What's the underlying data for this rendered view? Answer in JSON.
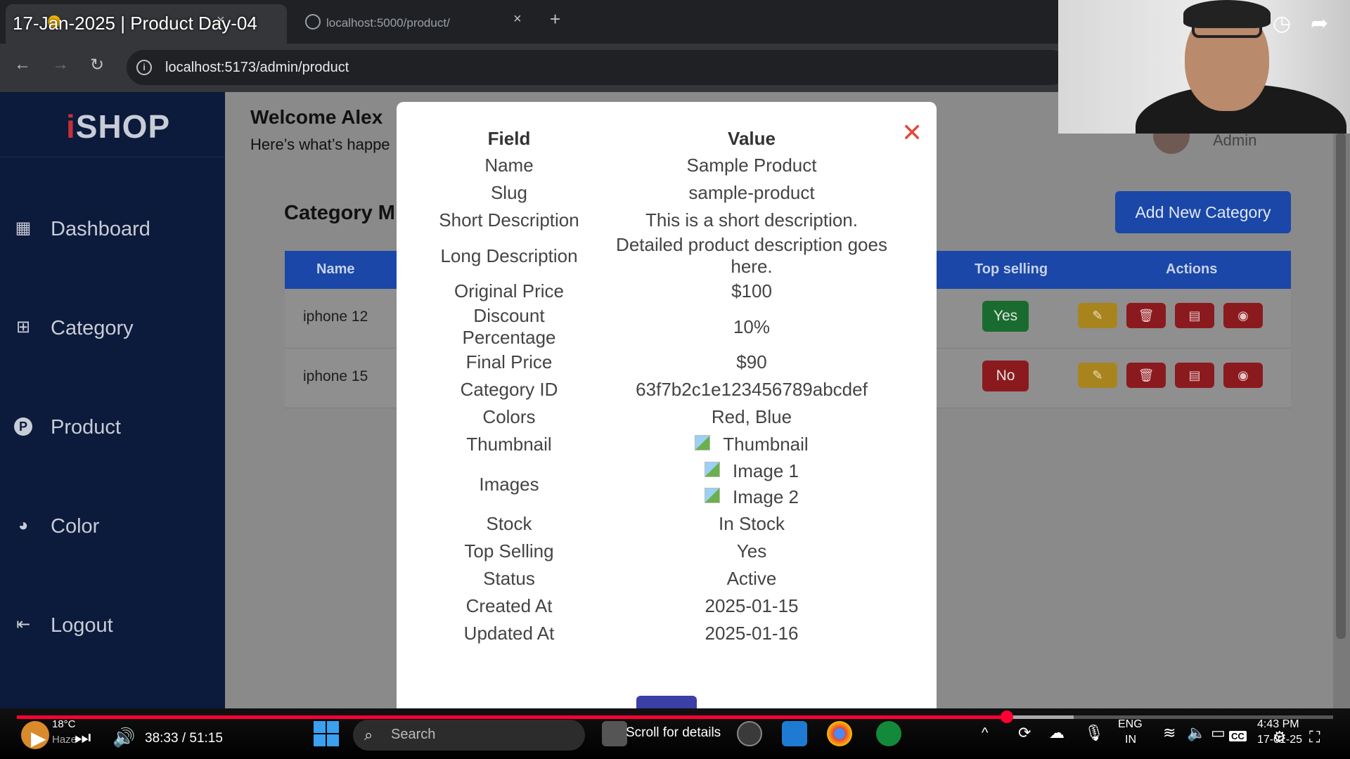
{
  "video": {
    "title": "17-Jan-2025 | Product Day-04"
  },
  "browser": {
    "tabs": [
      {
        "label": "",
        "url_label": ""
      },
      {
        "label": "localhost:5000/product/"
      }
    ],
    "address": "localhost:5173/admin/product"
  },
  "app": {
    "logo_i": "i",
    "logo_rest": "SHOP",
    "sidebar": [
      {
        "label": "Dashboard",
        "icon": "grid-icon"
      },
      {
        "label": "Category",
        "icon": "grid-plus-icon"
      },
      {
        "label": "Product",
        "icon": "product-p-icon"
      },
      {
        "label": "Color",
        "icon": "palette-icon"
      },
      {
        "label": "Logout",
        "icon": "logout-icon"
      }
    ],
    "header": {
      "welcome": "Welcome Alex",
      "subtitle": "Here’s what’s happe",
      "user_role": "Admin"
    },
    "section_title": "Category M",
    "add_button": "Add New Category",
    "table": {
      "headers": [
        "Name",
        "Top selling",
        "Actions"
      ],
      "rows": [
        {
          "name": "iphone 12",
          "top_selling": "Yes"
        },
        {
          "name": "iphone 15",
          "top_selling": "No"
        }
      ]
    }
  },
  "modal": {
    "header_field": "Field",
    "header_value": "Value",
    "rows": [
      {
        "field": "Name",
        "value": "Sample Product"
      },
      {
        "field": "Slug",
        "value": "sample-product"
      },
      {
        "field": "Short Description",
        "value": "This is a short description."
      },
      {
        "field": "Long Description",
        "value": "Detailed product description goes here."
      },
      {
        "field": "Original Price",
        "value": "$100"
      },
      {
        "field": "Discount Percentage",
        "value": "10%"
      },
      {
        "field": "Final Price",
        "value": "$90"
      },
      {
        "field": "Category ID",
        "value": "63f7b2c1e123456789abcdef"
      },
      {
        "field": "Colors",
        "value": "Red, Blue"
      }
    ],
    "thumbnail": {
      "field": "Thumbnail",
      "value": "Thumbnail"
    },
    "images": {
      "field": "Images",
      "values": [
        "Image 1",
        "Image 2"
      ]
    },
    "rows_after": [
      {
        "field": "Stock",
        "value": "In Stock"
      },
      {
        "field": "Top Selling",
        "value": "Yes"
      },
      {
        "field": "Status",
        "value": "Active"
      },
      {
        "field": "Created At",
        "value": "2025-01-15"
      },
      {
        "field": "Updated At",
        "value": "2025-01-16"
      }
    ]
  },
  "player": {
    "time": "38:33 / 51:15",
    "progress": 0.752
  },
  "taskbar": {
    "weather_temp": "18°C",
    "weather_desc": "Haze",
    "search_placeholder": "Search",
    "notification": "Scroll for details",
    "lang_top": "ENG",
    "lang_bottom": "IN",
    "clock_time": "4:43 PM",
    "clock_date": "17-01-25"
  },
  "colors": {
    "sidebar_bg": "#0c1a3b",
    "accent_blue": "#1a47a8",
    "success": "#1a6b2f",
    "danger": "#8b1a1f",
    "warning": "#a8841f",
    "close_red": "#e04a3c"
  }
}
